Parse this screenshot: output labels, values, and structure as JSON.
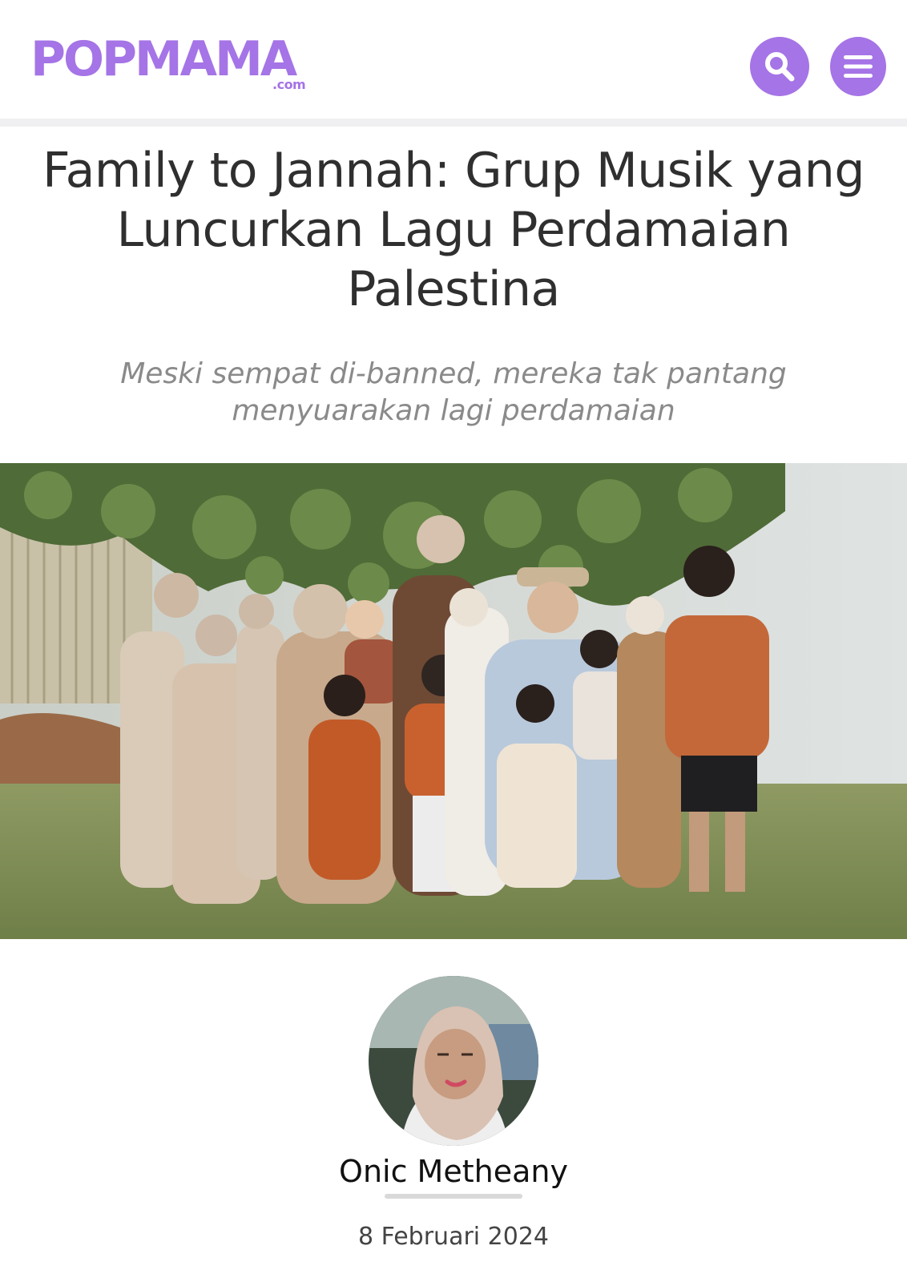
{
  "header": {
    "logo_main": "POPMAMA",
    "logo_sub": ".com",
    "search_icon": "search-icon",
    "menu_icon": "hamburger-menu-icon"
  },
  "article": {
    "title": "Family to Jannah: Grup Musik yang Luncurkan Lagu Perdamaian Palestina",
    "subtitle": "Meski sempat di-banned, mereka tak pantang menyuarakan lagi perdamaian"
  },
  "author": {
    "name": "Onic Metheany",
    "date": "8 Februari 2024"
  },
  "colors": {
    "brand": "#a574e6",
    "title_text": "#2f2f2f",
    "subtitle_text": "#8a8a8a"
  }
}
